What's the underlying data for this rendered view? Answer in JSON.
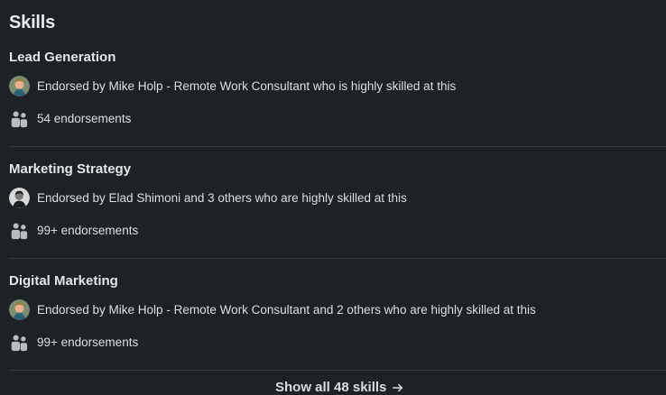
{
  "section": {
    "title": "Skills"
  },
  "skills": [
    {
      "name": "Lead Generation",
      "endorsement_note": "Endorsed by Mike Holp - Remote Work Consultant who is highly skilled at this",
      "endorsement_count": "54 endorsements",
      "avatar": "mike-holp-avatar"
    },
    {
      "name": "Marketing Strategy",
      "endorsement_note": "Endorsed by Elad Shimoni and 3 others who are highly skilled at this",
      "endorsement_count": "99+ endorsements",
      "avatar": "elad-shimoni-avatar"
    },
    {
      "name": "Digital Marketing",
      "endorsement_note": "Endorsed by Mike Holp - Remote Work Consultant and 2 others who are highly skilled at this",
      "endorsement_count": "99+ endorsements",
      "avatar": "mike-holp-avatar"
    }
  ],
  "show_all": {
    "label": "Show all 48 skills",
    "icon": "arrow-right-icon"
  },
  "colors": {
    "background": "#1d2226",
    "text": "#e9e9e9",
    "divider": "#3a3f43",
    "icon": "#b8bcbf"
  }
}
